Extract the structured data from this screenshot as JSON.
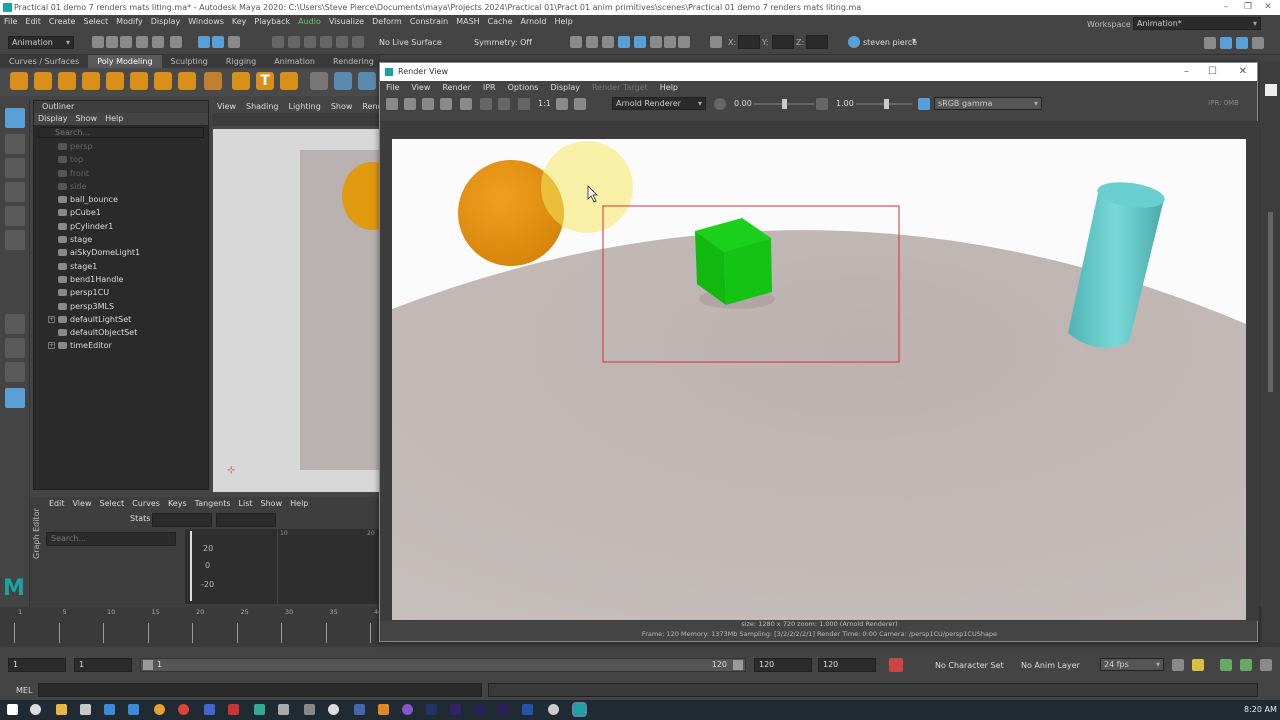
{
  "window": {
    "title": "Practical 01 demo 7 renders mats liting.ma* - Autodesk Maya 2020: C:\\Users\\Steve Pierce\\Documents\\maya\\Projects 2024\\Practical 01\\Pract 01 anim primitives\\scenes\\Practical 01 demo 7 renders mats liting.ma"
  },
  "menubar": [
    "File",
    "Edit",
    "Create",
    "Select",
    "Modify",
    "Display",
    "Windows",
    "Key",
    "Playback",
    "Audio",
    "Visualize",
    "Deform",
    "Constrain",
    "MASH",
    "Cache",
    "Arnold",
    "Help"
  ],
  "status": {
    "menuset": "Animation",
    "live_surface": "No Live Surface",
    "symmetry": "Symmetry: Off",
    "x_label": "X:",
    "y_label": "Y:",
    "z_label": "Z:",
    "user": "steven pierce",
    "workspace_label": "Workspace :",
    "workspace": "Animation*"
  },
  "shelf_tabs": [
    "Curves / Surfaces",
    "Poly Modeling",
    "Sculpting",
    "Rigging",
    "Animation",
    "Rendering"
  ],
  "outliner": {
    "title": "Outliner",
    "menu": [
      "Display",
      "Show",
      "Help"
    ],
    "search_placeholder": "Search...",
    "items": [
      {
        "name": "persp",
        "dim": true
      },
      {
        "name": "top",
        "dim": true
      },
      {
        "name": "front",
        "dim": true
      },
      {
        "name": "side",
        "dim": true
      },
      {
        "name": "ball_bounce",
        "dim": false
      },
      {
        "name": "pCube1",
        "dim": false
      },
      {
        "name": "pCylinder1",
        "dim": false
      },
      {
        "name": "stage",
        "dim": false
      },
      {
        "name": "aiSkyDomeLight1",
        "dim": false
      },
      {
        "name": "stage1",
        "dim": false
      },
      {
        "name": "bend1Handle",
        "dim": false
      },
      {
        "name": "persp1CU",
        "dim": false
      },
      {
        "name": "persp3MLS",
        "dim": false
      },
      {
        "name": "defaultLightSet",
        "dim": false,
        "expand": true
      },
      {
        "name": "defaultObjectSet",
        "dim": false
      },
      {
        "name": "timeEditor",
        "dim": false,
        "expand": true
      }
    ]
  },
  "viewport": {
    "menu": [
      "View",
      "Shading",
      "Lighting",
      "Show",
      "Renderer"
    ]
  },
  "graph_editor": {
    "side_label": "Graph Editor",
    "menu": [
      "Edit",
      "View",
      "Select",
      "Curves",
      "Keys",
      "Tangents",
      "List",
      "Show",
      "Help"
    ],
    "stats_label": "Stats",
    "search_placeholder": "Search...",
    "y_ticks": [
      "20",
      "0",
      "-20"
    ],
    "x_ticks": [
      "1",
      "10",
      "20"
    ]
  },
  "timeline": {
    "ticks": [
      "1",
      "5",
      "10",
      "15",
      "20",
      "25",
      "30",
      "35",
      "40"
    ]
  },
  "range": {
    "start": "1",
    "anim_start": "1",
    "slider_start": "1",
    "slider_end": "120",
    "anim_end": "120",
    "end": "120",
    "char_set": "No Character Set",
    "anim_layer": "No Anim Layer",
    "fps": "24 fps"
  },
  "cmdline": {
    "label": "MEL"
  },
  "taskbar": {
    "time": "8:20 AM"
  },
  "render_view": {
    "title": "Render View",
    "menu": [
      "File",
      "View",
      "Render",
      "IPR",
      "Options",
      "Display",
      "Render Target",
      "Help"
    ],
    "renderer": "Arnold Renderer",
    "exposure": "0.00",
    "gamma": "1.00",
    "colorspace": "sRGB gamma",
    "one_to_one": "1:1",
    "ipr_mem": "IPR: 0MB",
    "status_line1": "size: 1280 x 720  zoom: 1.000     (Arnold Renderer)",
    "status_line2": "Frame: 120     Memory: 1373Mb     Sampling: [3/2/2/2/2/1]     Render Time: 0:00     Camera: /persp1CU/persp1CUShape"
  },
  "colors": {
    "accent": "#5aa0d8",
    "maya_teal": "#1aa3a3",
    "ball": "#e8940f",
    "cube": "#11c011",
    "cylinder": "#5cc4c4",
    "floor": "#b8adab",
    "region": "#d83030"
  }
}
